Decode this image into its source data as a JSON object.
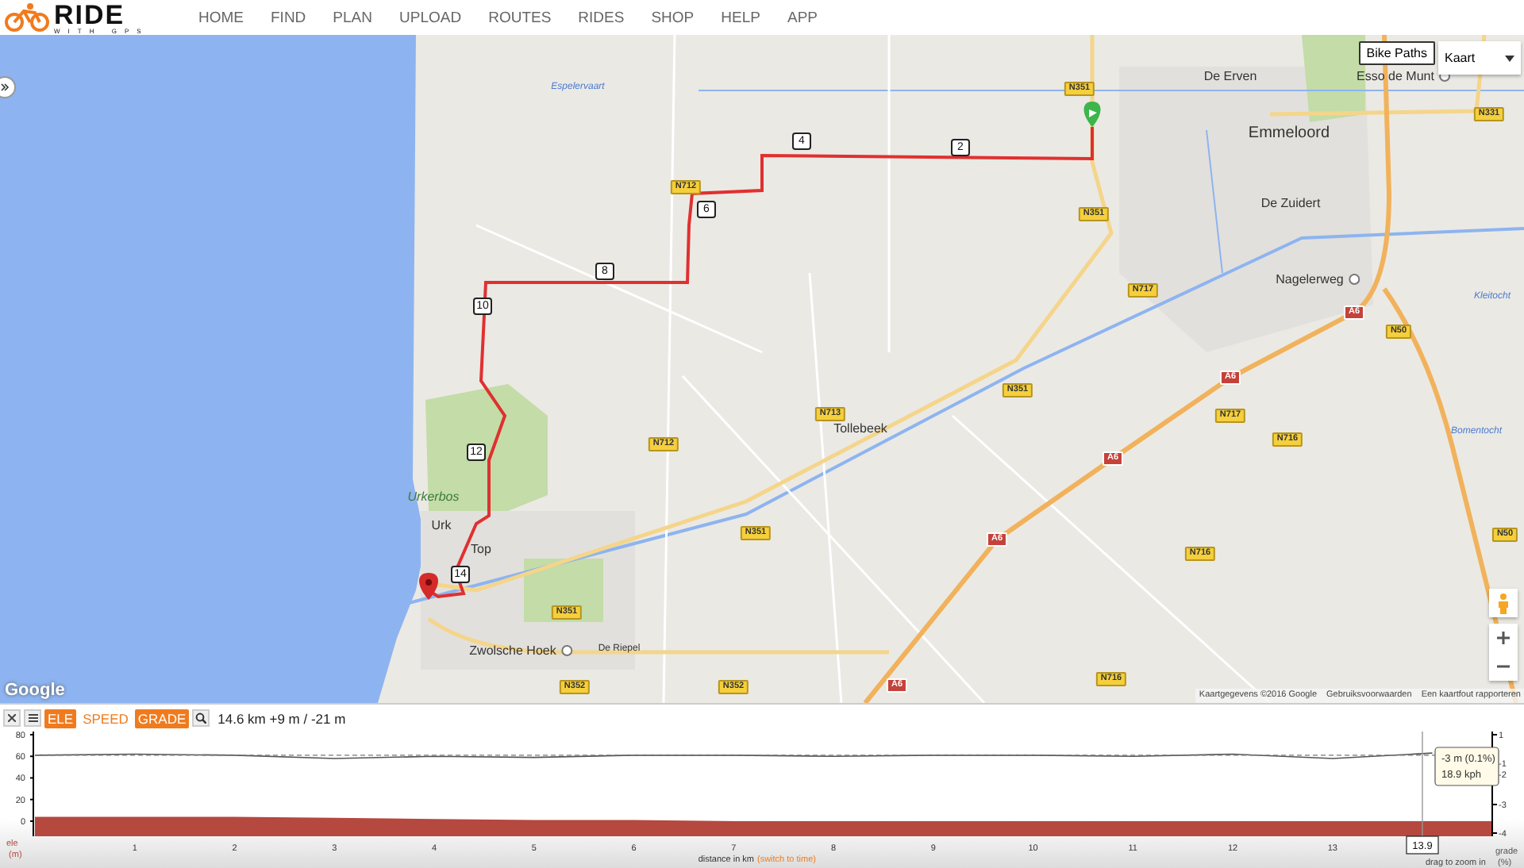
{
  "header": {
    "logo": {
      "word": "RIDE",
      "sub": "WITH GPS"
    },
    "nav": [
      "HOME",
      "FIND",
      "PLAN",
      "UPLOAD",
      "ROUTES",
      "RIDES",
      "SHOP",
      "HELP",
      "APP"
    ]
  },
  "map": {
    "bike_paths_button": "Bike Paths",
    "map_type": "Kaart",
    "place_labels": [
      {
        "text": "De Erven",
        "kind": "town"
      },
      {
        "text": "Esso de Munt",
        "kind": "poi"
      },
      {
        "text": "Emmeloord",
        "kind": "city"
      },
      {
        "text": "De Zuidert",
        "kind": "town"
      },
      {
        "text": "Nagelerweg",
        "kind": "poi"
      },
      {
        "text": "Tollebeek",
        "kind": "town"
      },
      {
        "text": "Urkerbos",
        "kind": "park"
      },
      {
        "text": "Urk",
        "kind": "town"
      },
      {
        "text": "Top",
        "kind": "town"
      },
      {
        "text": "Zwolsche Hoek",
        "kind": "poi"
      },
      {
        "text": "De Riepel",
        "kind": "small"
      },
      {
        "text": "Espelervaart",
        "kind": "water"
      },
      {
        "text": "Kleitocht",
        "kind": "water"
      },
      {
        "text": "Bomentocht",
        "kind": "water"
      }
    ],
    "road_shields": [
      {
        "text": "N351",
        "kind": "national"
      },
      {
        "text": "N351",
        "kind": "national"
      },
      {
        "text": "N717",
        "kind": "national"
      },
      {
        "text": "N351",
        "kind": "national"
      },
      {
        "text": "N712",
        "kind": "national"
      },
      {
        "text": "N712",
        "kind": "national"
      },
      {
        "text": "N713",
        "kind": "national"
      },
      {
        "text": "N351",
        "kind": "national"
      },
      {
        "text": "N351",
        "kind": "national"
      },
      {
        "text": "N352",
        "kind": "national"
      },
      {
        "text": "N352",
        "kind": "national"
      },
      {
        "text": "N331",
        "kind": "national"
      },
      {
        "text": "A6",
        "kind": "motorway"
      },
      {
        "text": "N50",
        "kind": "national"
      },
      {
        "text": "A6",
        "kind": "motorway"
      },
      {
        "text": "N717",
        "kind": "national"
      },
      {
        "text": "N716",
        "kind": "national"
      },
      {
        "text": "A6",
        "kind": "motorway"
      },
      {
        "text": "A6",
        "kind": "motorway"
      },
      {
        "text": "N716",
        "kind": "national"
      },
      {
        "text": "N716",
        "kind": "national"
      },
      {
        "text": "N50",
        "kind": "national"
      },
      {
        "text": "A6",
        "kind": "motorway"
      }
    ],
    "route_markers": [
      "2",
      "4",
      "6",
      "8",
      "10",
      "12",
      "14"
    ],
    "google_logo": "Google",
    "attribution": [
      "Kaartgegevens ©2016 Google",
      "Gebruiksvoorwaarden",
      "Een kaartfout rapporteren"
    ]
  },
  "elevation_panel": {
    "modes": [
      {
        "label": "ELE",
        "selected": true
      },
      {
        "label": "SPEED",
        "selected": false
      },
      {
        "label": "GRADE",
        "selected": true
      }
    ],
    "summary": "14.6 km +9 m / -21 m",
    "right_axis": {
      "ticks": [
        "1",
        "-1",
        "-2",
        "-3",
        "-4"
      ]
    },
    "switch_link": "(switch to time)",
    "tooltip": [
      "-3 m (0.1%)",
      "18.9 kph"
    ],
    "cursor_label": "13.9",
    "hint": "drag to zoom in",
    "chart_data": {
      "type": "line",
      "xlabel": "distance in km",
      "x": [
        0,
        1,
        2,
        3,
        4,
        5,
        6,
        7,
        8,
        9,
        10,
        11,
        12,
        13,
        14,
        14.6
      ],
      "series": [
        {
          "name": "ele (m)",
          "type": "area",
          "color": "#b5483f",
          "values": [
            4,
            4,
            4,
            3,
            2,
            1,
            1,
            0,
            0,
            0,
            0,
            0,
            0,
            0,
            0,
            0
          ]
        },
        {
          "name": "grade (%)",
          "type": "line",
          "color": "#555555",
          "values": [
            61,
            62,
            61,
            58,
            60,
            59,
            61,
            61,
            60,
            61,
            61,
            60,
            62,
            58,
            63,
            null
          ]
        }
      ],
      "bands": [
        {
          "axis": "y",
          "from": -14,
          "to": 0,
          "color": "#b5483f"
        }
      ],
      "ref_lines": [
        {
          "axis": "y",
          "value": 61
        },
        {
          "axis": "x",
          "value": 13.9
        }
      ],
      "xlim": [
        0,
        14.6
      ],
      "ylim": [
        -14,
        80
      ],
      "yticks": [
        0,
        20,
        40,
        60,
        80
      ],
      "xticks": [
        1,
        2,
        3,
        4,
        5,
        6,
        7,
        8,
        9,
        10,
        11,
        12,
        13
      ]
    }
  }
}
